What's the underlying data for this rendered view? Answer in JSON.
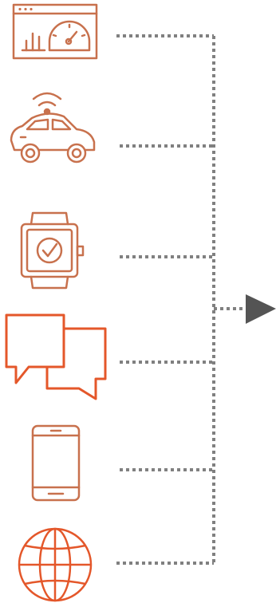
{
  "colors": {
    "icon_stroke": "#c8714d",
    "icon_stroke_bright": "#e4572a",
    "connector": "#808080",
    "arrow": "#545454",
    "background": "#ffffff"
  },
  "sources": [
    {
      "id": "dashboard",
      "icon": "dashboard-gauge-chart-icon"
    },
    {
      "id": "connected-car",
      "icon": "connected-car-icon"
    },
    {
      "id": "smartwatch",
      "icon": "smartwatch-icon"
    },
    {
      "id": "chat",
      "icon": "chat-bubbles-icon"
    },
    {
      "id": "smartphone",
      "icon": "smartphone-icon"
    },
    {
      "id": "web",
      "icon": "globe-icon"
    }
  ],
  "output": {
    "icon": "arrow-right-icon"
  }
}
